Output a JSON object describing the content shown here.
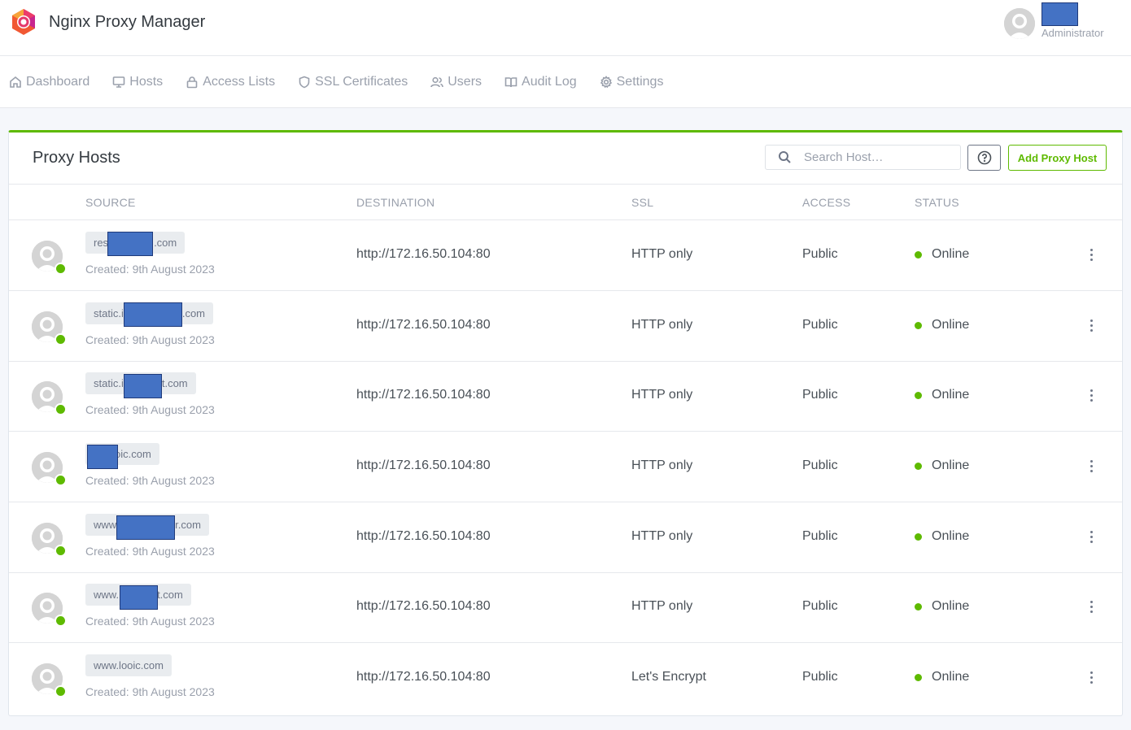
{
  "app": {
    "title": "Nginx Proxy Manager"
  },
  "user": {
    "role": "Administrator"
  },
  "nav": {
    "items": [
      {
        "label": "Dashboard",
        "icon": "home-icon"
      },
      {
        "label": "Hosts",
        "icon": "monitor-icon"
      },
      {
        "label": "Access Lists",
        "icon": "lock-icon"
      },
      {
        "label": "SSL Certificates",
        "icon": "shield-icon"
      },
      {
        "label": "Users",
        "icon": "users-icon"
      },
      {
        "label": "Audit Log",
        "icon": "book-icon"
      },
      {
        "label": "Settings",
        "icon": "gear-icon"
      }
    ]
  },
  "card": {
    "title": "Proxy Hosts",
    "search_placeholder": "Search Host…",
    "add_button": "Add Proxy Host"
  },
  "table": {
    "headers": {
      "source": "SOURCE",
      "destination": "DESTINATION",
      "ssl": "SSL",
      "access": "ACCESS",
      "status": "STATUS"
    },
    "rows": [
      {
        "source": "res",
        "source_suffix": ".com",
        "created": "Created: 9th August 2023",
        "destination": "http://172.16.50.104:80",
        "ssl": "HTTP only",
        "access": "Public",
        "status": "Online"
      },
      {
        "source": "static.i",
        "source_suffix": ".com",
        "created": "Created: 9th August 2023",
        "destination": "http://172.16.50.104:80",
        "ssl": "HTTP only",
        "access": "Public",
        "status": "Online"
      },
      {
        "source": "static.i",
        "source_suffix": "t.com",
        "created": "Created: 9th August 2023",
        "destination": "http://172.16.50.104:80",
        "ssl": "HTTP only",
        "access": "Public",
        "status": "Online"
      },
      {
        "source": "",
        "source_suffix": "oic.com",
        "created": "Created: 9th August 2023",
        "destination": "http://172.16.50.104:80",
        "ssl": "HTTP only",
        "access": "Public",
        "status": "Online"
      },
      {
        "source": "www",
        "source_suffix": "r.com",
        "created": "Created: 9th August 2023",
        "destination": "http://172.16.50.104:80",
        "ssl": "HTTP only",
        "access": "Public",
        "status": "Online"
      },
      {
        "source": "www.",
        "source_suffix": "t.com",
        "created": "Created: 9th August 2023",
        "destination": "http://172.16.50.104:80",
        "ssl": "HTTP only",
        "access": "Public",
        "status": "Online"
      },
      {
        "source": "www.looic.com",
        "source_suffix": "",
        "created": "Created: 9th August 2023",
        "destination": "http://172.16.50.104:80",
        "ssl": "Let's Encrypt",
        "access": "Public",
        "status": "Online"
      }
    ]
  },
  "colors": {
    "accent": "#5eba00",
    "redaction": "#4472c4"
  }
}
